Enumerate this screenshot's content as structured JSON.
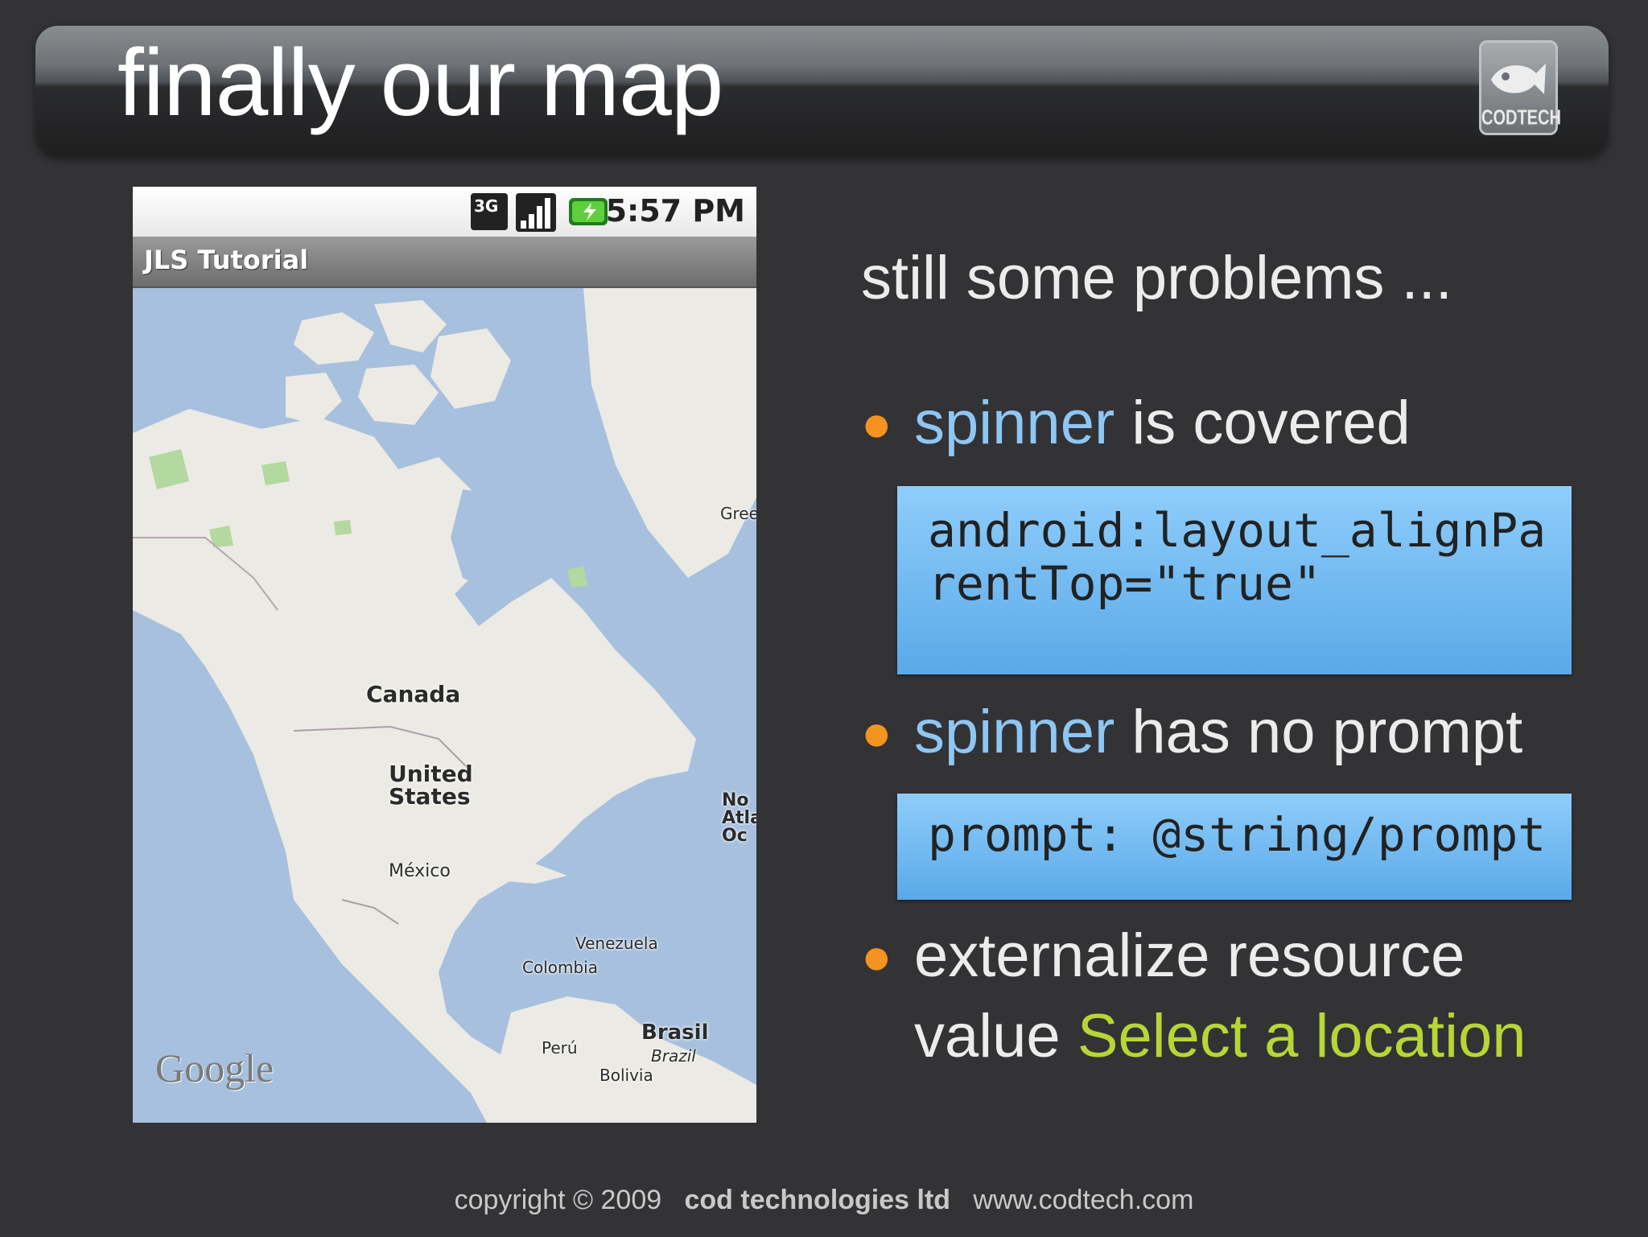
{
  "slide": {
    "title": "finally our map",
    "logo_text": "CODTECH"
  },
  "phone": {
    "status": {
      "network": "3G",
      "time": "5:57 PM"
    },
    "app_title": "JLS Tutorial",
    "map": {
      "labels": {
        "greenland": "Gree",
        "canada": "Canada",
        "united_states_1": "United",
        "united_states_2": "States",
        "mexico": "México",
        "north_atlantic_1": "No",
        "north_atlantic_2": "Atla",
        "north_atlantic_3": "Oc",
        "venezuela": "Venezuela",
        "colombia": "Colombia",
        "peru": "Perú",
        "brasil": "Brasil",
        "brazil": "Brazil",
        "bolivia": "Bolivia"
      },
      "attribution": "Google"
    }
  },
  "content": {
    "heading": "still some problems ...",
    "bullet1_kw": "spinner",
    "bullet1_rest": " is covered",
    "code1_line1": "android:layout_alignPa",
    "code1_line2": "rentTop=\"true\"",
    "bullet2_kw": "spinner",
    "bullet2_rest": " has no prompt",
    "code2_line1": "prompt: @string/prompt",
    "bullet3_line1": "externalize resource",
    "bullet3_line2_pre": "value ",
    "bullet3_line2_hl": "Select a location"
  },
  "footer": {
    "copyright": "copyright © 2009",
    "company": "cod technologies ltd",
    "url": "www.codtech.com"
  },
  "colors": {
    "background": "#333235",
    "bullet_dot": "#f4931f",
    "keyword": "#8ec6f4",
    "highlight": "#b7d635",
    "code_box": "#6eb8f0"
  }
}
